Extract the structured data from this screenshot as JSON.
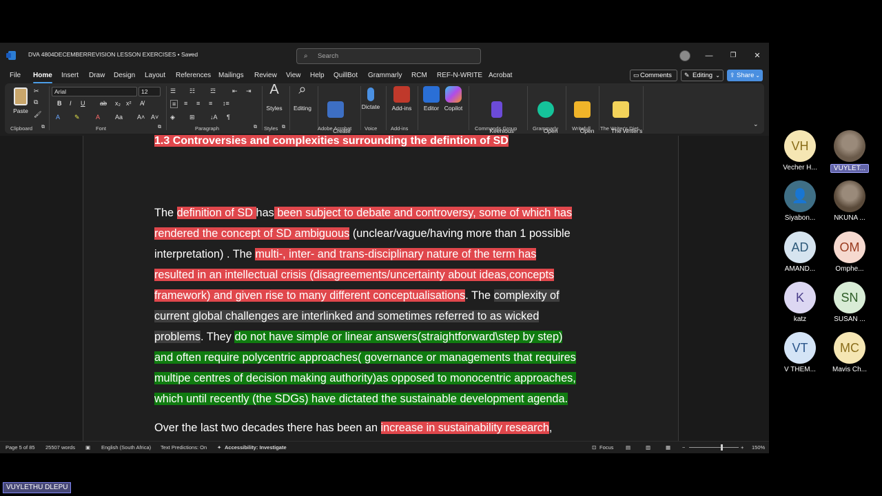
{
  "window": {
    "doc_title": "DVA 4804DECEMBERREVISION LESSON EXERCISES • Saved",
    "search_placeholder": "Search",
    "minimize_icon": "—",
    "restore_icon": "❐",
    "close_icon": "✕"
  },
  "menu": [
    "File",
    "Home",
    "Insert",
    "Draw",
    "Design",
    "Layout",
    "References",
    "Mailings",
    "Review",
    "View",
    "Help",
    "QuillBot",
    "Grammarly",
    "RCM",
    "REF-N-WRITE",
    "Acrobat"
  ],
  "menu_active": "Home",
  "header_buttons": {
    "comments": "Comments",
    "editing": "Editing",
    "share": "Share"
  },
  "ribbon": {
    "paste": "Paste",
    "font_name": "Arial",
    "font_size": "12",
    "group_clipboard": "Clipboard",
    "group_font": "Font",
    "group_paragraph": "Paragraph",
    "group_styles": "Styles",
    "styles": "Styles",
    "editing": "Editing",
    "create_pdf": "Create\na PDF",
    "dictate": "Dictate",
    "addins": "Add-ins",
    "editor": "Editor",
    "copilot": "Copilot",
    "keenious": "Keenious\nResearch Explorer",
    "open_grammarly": "Open\nGrammarly",
    "open_writefull": "Open\nWritefull",
    "writers_diet": "The Writer's\nDiet",
    "group_adobe": "Adobe Acrobat",
    "group_voice": "Voice",
    "group_addins": "Add-ins",
    "group_commands": "Commands Group",
    "group_grammarly": "Grammarly",
    "group_writefull": "Writefull",
    "group_writers_diet": "The Writer's Diet"
  },
  "document": {
    "heading": "1.3 Controversies and complexities surrounding the defintion of SD",
    "lines": [
      [
        [
          "The ",
          ""
        ],
        [
          "definition of SD ",
          "r"
        ],
        [
          "has",
          ""
        ],
        [
          " been subject to debate and controversy, some of which has",
          "r"
        ]
      ],
      [
        [
          "rendered the concept of SD ambiguous",
          "r"
        ],
        [
          " (unclear/vague/having more than 1 possible",
          ""
        ]
      ],
      [
        [
          "interpretation) . The ",
          ""
        ],
        [
          "multi-, inter- and trans-disciplinary nature of the term has",
          "r"
        ]
      ],
      [
        [
          "resulted in an intellectual crisis (disagreements/uncertainty about ideas,concepts",
          "r"
        ]
      ],
      [
        [
          "framework) and given rise to many different conceptualisations",
          "r"
        ],
        [
          ". The ",
          ""
        ],
        [
          "complexity of",
          "gr"
        ]
      ],
      [
        [
          "current global challenges are interlinked and sometimes referred to as wicked",
          "gr"
        ]
      ],
      [
        [
          "problems",
          "gr"
        ],
        [
          ". They ",
          ""
        ],
        [
          "do not have simple or linear answers(straightforward\\step by step)",
          "g"
        ]
      ],
      [
        [
          "and often require polycentric approaches( governance or managements that requires",
          "g"
        ]
      ],
      [
        [
          "multipe centres of decision making authority)as opposed to monocentric approaches,",
          "g"
        ]
      ],
      [
        [
          "which until recently (the SDGs) have dictated the sustainable development agenda.",
          "g"
        ]
      ],
      [
        [
          "Over the last two decades there has been an ",
          ""
        ],
        [
          "increase in sustainability research",
          "r"
        ],
        [
          ",",
          ""
        ]
      ]
    ]
  },
  "status": {
    "page": "Page 5 of 85",
    "words": "25507 words",
    "language": "English (South Africa)",
    "predictions": "Text Predictions: On",
    "accessibility": "Accessibility: Investigate",
    "focus": "Focus",
    "zoom": "150%",
    "zoom_fraction": 0.65
  },
  "participants": [
    {
      "initials": "VH",
      "name": "Vecher H...",
      "bg": "#f5e6b3",
      "fg": "#8a6d1a"
    },
    {
      "initials": "",
      "name": "VUYLET...",
      "bg": "#6a5a4a",
      "fg": "#fff",
      "photo": true,
      "selected": true
    },
    {
      "initials": "",
      "name": "Siyabon...",
      "bg": "#3f6f86",
      "fg": "#fff",
      "person_icon": true
    },
    {
      "initials": "",
      "name": "NKUNA ...",
      "bg": "#5a4a3a",
      "fg": "#fff",
      "photo": true
    },
    {
      "initials": "AD",
      "name": "AMAND...",
      "bg": "#d6e4ef",
      "fg": "#2e5a7a"
    },
    {
      "initials": "OM",
      "name": "Omphe...",
      "bg": "#f6d9cf",
      "fg": "#9a3b1f"
    },
    {
      "initials": "K",
      "name": "katz",
      "bg": "#dcd7f2",
      "fg": "#4a3e8a"
    },
    {
      "initials": "SN",
      "name": "SUSAN ...",
      "bg": "#d8ecd6",
      "fg": "#2e5e28"
    },
    {
      "initials": "VT",
      "name": "V THEM...",
      "bg": "#d4e4f6",
      "fg": "#2a558a"
    },
    {
      "initials": "MC",
      "name": "Mavis Ch...",
      "bg": "#f5e6b3",
      "fg": "#8a6d1a"
    }
  ],
  "presenter_name": "VUYLETHU DLEPU"
}
